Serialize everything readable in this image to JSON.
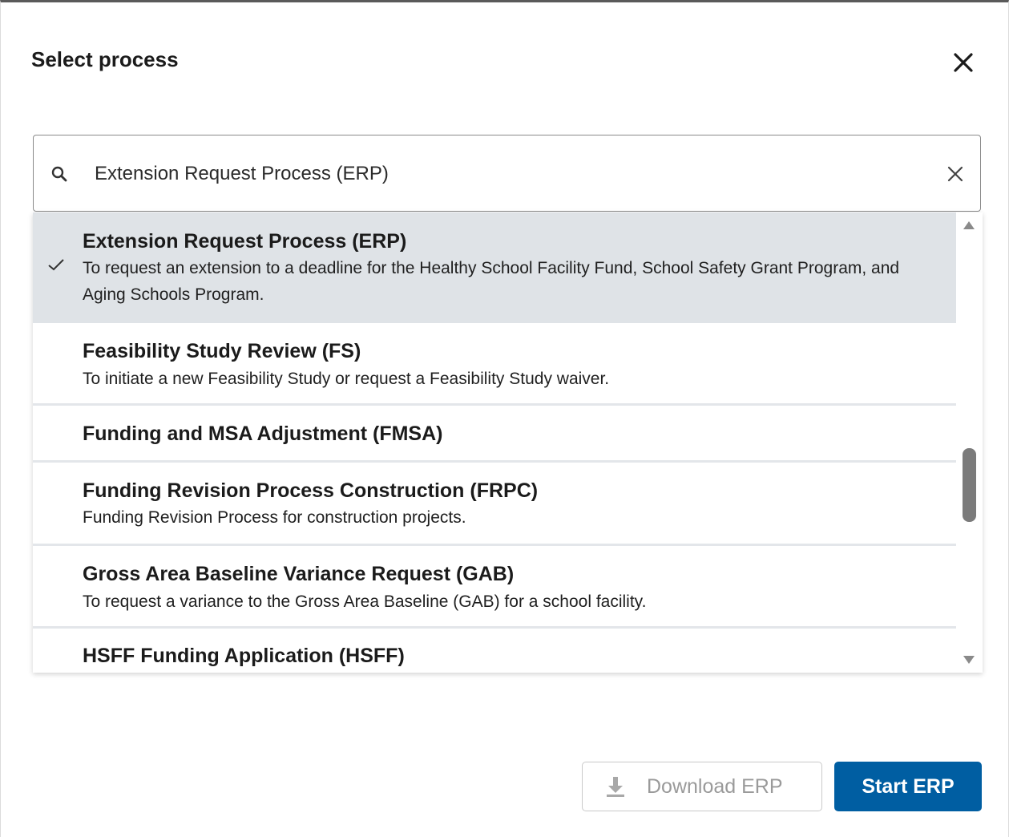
{
  "dialog": {
    "title": "Select process"
  },
  "search": {
    "value": "Extension Request Process (ERP)",
    "icon": "search-icon"
  },
  "processes": [
    {
      "title": "Extension Request Process (ERP)",
      "description": "To request an extension to a deadline for the Healthy School Facility Fund, School Safety Grant Program, and Aging Schools Program.",
      "selected": true
    },
    {
      "title": "Feasibility Study Review (FS)",
      "description": "To initiate a new Feasibility Study or request a Feasibility Study waiver."
    },
    {
      "title": "Funding and MSA Adjustment (FMSA)",
      "description": ""
    },
    {
      "title": "Funding Revision Process Construction (FRPC)",
      "description": "Funding Revision Process for construction projects."
    },
    {
      "title": "Gross Area Baseline Variance Request (GAB)",
      "description": "To request a variance to the Gross Area Baseline (GAB) for a school facility."
    },
    {
      "title": "HSFF Funding Application (HSFF)",
      "description": ""
    }
  ],
  "buttons": {
    "download_label": "Download ERP",
    "start_label": "Start ERP"
  },
  "colors": {
    "primary": "#005ea2",
    "selected_row": "#dfe3e7",
    "disabled_text": "#9a9a9a"
  }
}
